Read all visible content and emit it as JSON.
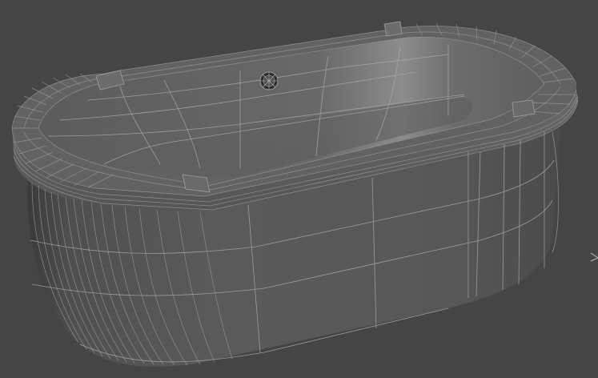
{
  "viewport": {
    "mode": "wireframe-on-shaded",
    "background_color": "#454545",
    "object_color": "#5e5e5e",
    "wire_color": "#a8a8a8",
    "object": "bathtub-mesh"
  }
}
